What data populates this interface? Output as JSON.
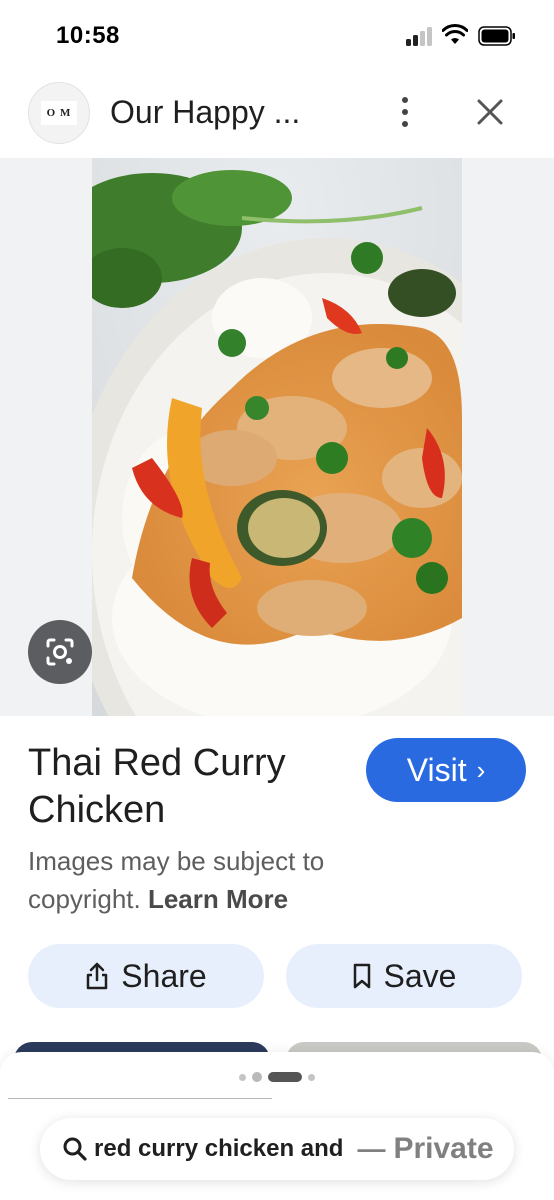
{
  "status_bar": {
    "time": "10:58"
  },
  "header": {
    "site_name": "Our Happy ...",
    "avatar_text": "O M"
  },
  "result": {
    "title": "Thai Red Curry Chicken",
    "visit_label": "Visit",
    "copyright_text": "Images may be subject to copyright.",
    "learn_more": "Learn More"
  },
  "actions": {
    "share_label": "Share",
    "save_label": "Save"
  },
  "address_bar": {
    "query": "red curry chicken and",
    "separator": "—",
    "mode": "Private"
  },
  "colors": {
    "visit_button": "#2a6ae0",
    "pill_background": "#e8effc",
    "image_background": "#f0f2f4"
  },
  "icons": [
    "signal-icon",
    "wifi-icon",
    "battery-icon",
    "more-icon",
    "close-icon",
    "lens-icon",
    "share-icon",
    "bookmark-icon",
    "search-icon"
  ]
}
